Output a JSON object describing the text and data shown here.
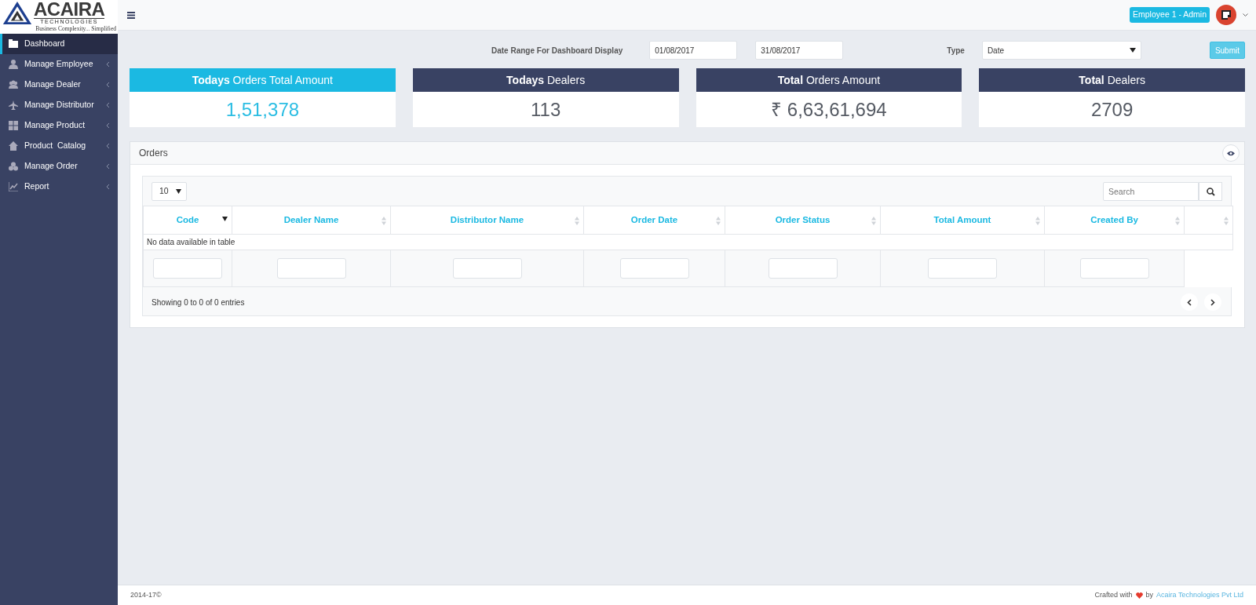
{
  "brand": {
    "name": "ACAIRA",
    "subtitle": "TECHNOLOGIES",
    "tagline": "Business Complexity... Simplified"
  },
  "topbar": {
    "user_badge": "Employee 1 - Admin"
  },
  "sidebar": {
    "items": [
      {
        "label": "Dashboard",
        "selected": true,
        "has_submenu": false
      },
      {
        "label": "Manage Employee",
        "selected": false,
        "has_submenu": true
      },
      {
        "label": "Manage Dealer",
        "selected": false,
        "has_submenu": true
      },
      {
        "label": "Manage Distributor",
        "selected": false,
        "has_submenu": true
      },
      {
        "label": "Manage Product",
        "selected": false,
        "has_submenu": true
      },
      {
        "label": "Product  Catalog",
        "selected": false,
        "has_submenu": true
      },
      {
        "label": "Manage Order",
        "selected": false,
        "has_submenu": true
      },
      {
        "label": "Report",
        "selected": false,
        "has_submenu": true
      }
    ]
  },
  "filters": {
    "date_range_label": "Date Range For Dashboard Display",
    "from": "01/08/2017",
    "to": "31/08/2017",
    "type_label": "Type",
    "type_value": "Date",
    "submit": "Submit"
  },
  "stats": [
    {
      "title": "**Todays** Orders Total Amount",
      "value": "1,51,378",
      "color": "#1bb9e2",
      "kind": "highlight"
    },
    {
      "title": "**Todays** Dealers",
      "value": "113",
      "color": "#394263",
      "kind": "plain"
    },
    {
      "title": "**Total** Orders Amount",
      "value": "₹ 6,63,61,694",
      "color": "#394263",
      "kind": "plain"
    },
    {
      "title": "**Total** Dealers",
      "value": "2709",
      "color": "#394263",
      "kind": "plain"
    }
  ],
  "orders": {
    "title": "Orders",
    "page_length": "10",
    "search_placeholder": "Search",
    "columns": [
      {
        "label": "Code",
        "sorted": true,
        "filter": true
      },
      {
        "label": "Dealer Name",
        "sorted": false,
        "filter": true
      },
      {
        "label": "Distributor Name",
        "sorted": false,
        "filter": true
      },
      {
        "label": "Order Date",
        "sorted": false,
        "filter": true
      },
      {
        "label": "Order Status",
        "sorted": false,
        "filter": true
      },
      {
        "label": "Total Amount",
        "sorted": false,
        "filter": true
      },
      {
        "label": "Created By",
        "sorted": false,
        "filter": true
      },
      {
        "sorted": false,
        "filter": false
      }
    ],
    "empty_message": "No data available in table",
    "info": "Showing 0 to 0 of 0 entries"
  },
  "footer": {
    "copyright": "2014-17©",
    "credit_prefix": "Crafted with",
    "credit_by": "by",
    "credit_link": "Acaira Technologies Pvt Ltd"
  }
}
